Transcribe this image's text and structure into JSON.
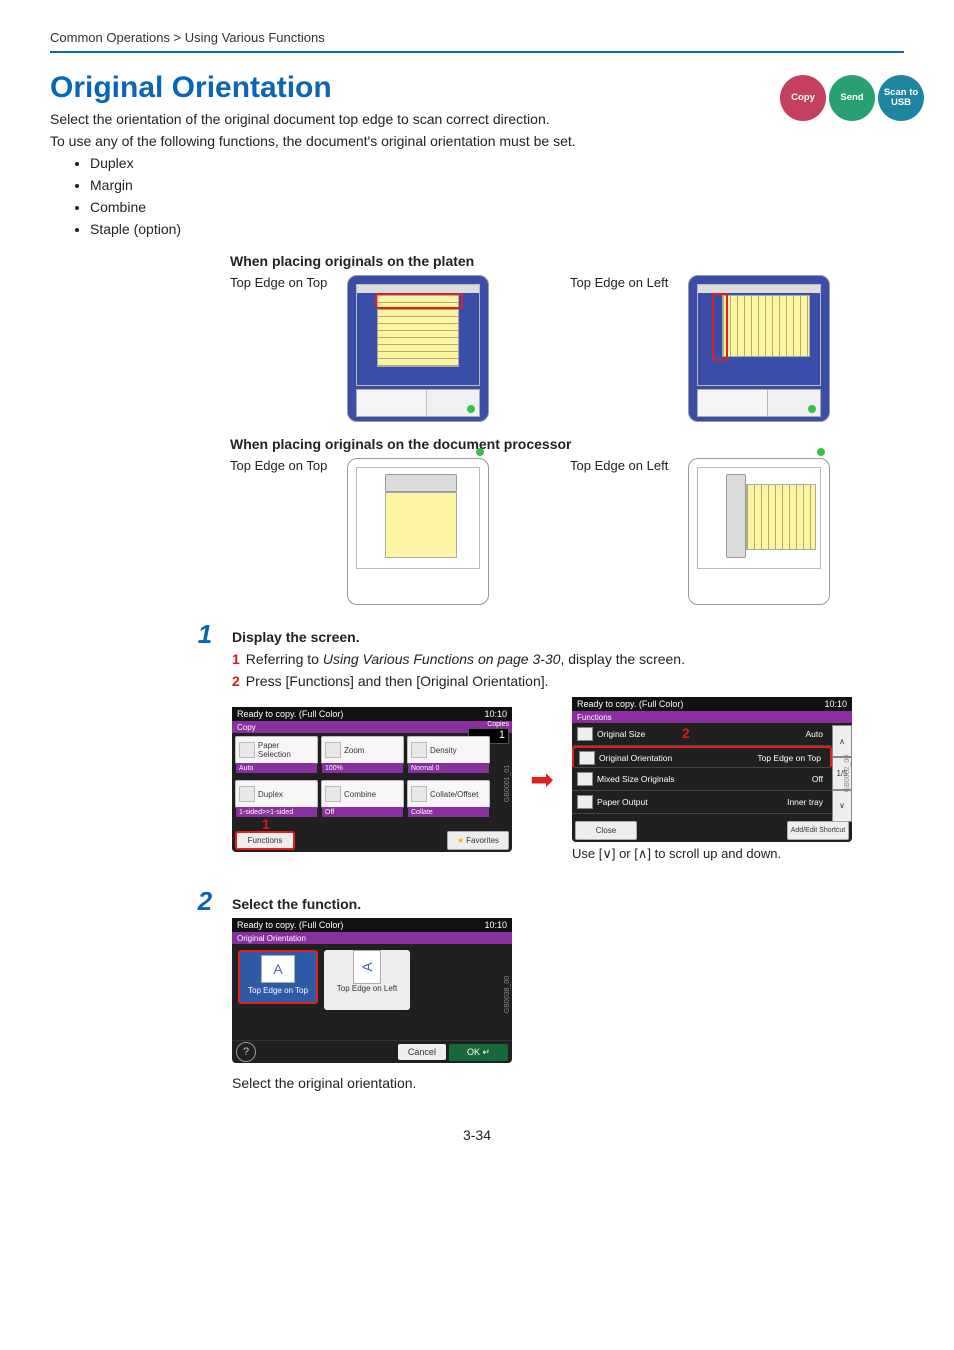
{
  "breadcrumb": "Common Operations > Using Various Functions",
  "title": "Original Orientation",
  "intro1": "Select the orientation of the original document top edge to scan correct direction.",
  "intro2": "To use any of the following functions, the document's original orientation must be set.",
  "bullets": [
    "Duplex",
    "Margin",
    "Combine",
    "Staple (option)"
  ],
  "badges": {
    "copy": "Copy",
    "send": "Send",
    "usb": "Scan to USB"
  },
  "platen_h": "When placing originals on the platen",
  "dp_h": "When placing originals on the document processor",
  "top_top": "Top Edge on Top",
  "top_left": "Top Edge on Left",
  "step1_title": "Display the screen.",
  "step1_1a": "Referring to ",
  "step1_1b": "Using Various Functions on page 3-30",
  "step1_1c": ", display the screen.",
  "step1_2": "Press [Functions] and then [Original Orientation].",
  "scroll": "Use [∨] or [∧] to scroll up and down.",
  "step2_title": "Select the function.",
  "step2_note": "Select the original orientation.",
  "pnum": "3-34",
  "sc1": {
    "status": "Ready to copy. (Full Color)",
    "time": "10:10",
    "tab": "Copy",
    "copies_l": "Copies",
    "copies_n": "1",
    "b1": "Paper Selection",
    "b2": "Zoom",
    "b3": "Density",
    "s1": "Auto",
    "s2": "100%",
    "s3": "Normal 0",
    "b4": "Duplex",
    "b5": "Combine",
    "b6": "Collate/Offset",
    "s4": "1-sided>>1-sided",
    "s5": "Off",
    "s6": "Collate",
    "func": "Functions",
    "fav": "Favorites",
    "code": "GB0001_01",
    "callout": "1"
  },
  "sc2": {
    "status": "Ready to copy. (Full Color)",
    "time": "10:10",
    "tab": "Functions",
    "r1": "Original Size",
    "v1": "Auto",
    "r2": "Original Orientation",
    "v2": "Top Edge on Top",
    "r3": "Mixed Size Originals",
    "v3": "Off",
    "r4": "Paper Output",
    "v4": "Inner tray",
    "page": "1/5",
    "close": "Close",
    "short": "Add/Edit Shortcut",
    "code": "GB0002_00",
    "callout": "2"
  },
  "sc3": {
    "status": "Ready to copy. (Full Color)",
    "time": "10:10",
    "tab": "Original Orientation",
    "o1": "Top Edge on Top",
    "o2": "Top Edge on Left",
    "cancel": "Cancel",
    "ok": "OK",
    "code": "GB0038_00"
  }
}
